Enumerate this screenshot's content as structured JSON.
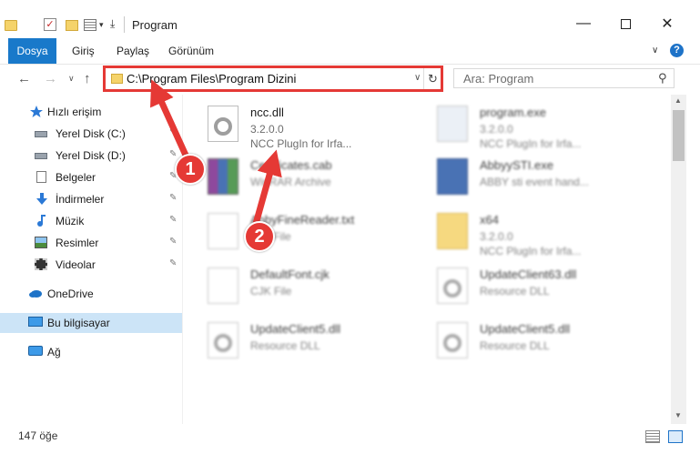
{
  "window": {
    "title": "Program",
    "controls": {
      "minimize": "—",
      "close": "✕"
    }
  },
  "ribbon": {
    "tabs": [
      {
        "label": "Dosya",
        "active": true
      },
      {
        "label": "Giriş"
      },
      {
        "label": "Paylaş"
      },
      {
        "label": "Görünüm"
      }
    ],
    "collapse_glyph": "∨",
    "help_glyph": "?"
  },
  "navigation": {
    "back_glyph": "←",
    "forward_glyph": "→",
    "recent_glyph": "∨",
    "up_glyph": "↑",
    "address": "C:\\Program Files\\Program Dizini",
    "address_dropdown_glyph": "∨",
    "refresh_glyph": "↻",
    "search_placeholder": "Ara: Program",
    "search_glyph": "⚲"
  },
  "sidebar": {
    "items": [
      {
        "label": "Hızlı erişim",
        "icon": "star-icon"
      },
      {
        "label": "Yerel Disk (C:)",
        "icon": "drive-icon",
        "pinned": true
      },
      {
        "label": "Yerel Disk (D:)",
        "icon": "drive-icon",
        "pinned": true
      },
      {
        "label": "Belgeler",
        "icon": "documents-icon",
        "pinned": true
      },
      {
        "label": "İndirmeler",
        "icon": "download-icon",
        "pinned": true
      },
      {
        "label": "Müzik",
        "icon": "music-icon",
        "pinned": true
      },
      {
        "label": "Resimler",
        "icon": "pictures-icon",
        "pinned": true
      },
      {
        "label": "Videolar",
        "icon": "video-icon",
        "pinned": true
      },
      {
        "label": "OneDrive",
        "icon": "cloud-icon"
      },
      {
        "label": "Bu bilgisayar",
        "icon": "computer-icon",
        "selected": true
      },
      {
        "label": "Ağ",
        "icon": "network-icon"
      }
    ],
    "pin_glyph": "✎"
  },
  "files": [
    {
      "name": "ncc.dll",
      "line1": "3.2.0.0",
      "line2": "NCC PlugIn for Irfa...",
      "icon": "dll-gear-icon",
      "highlighted": true
    },
    {
      "name": "program.exe",
      "line1": "3.2.0.0",
      "line2": "NCC PlugIn for Irfa...",
      "icon": "exe-icon"
    },
    {
      "name": "Certificates.cab",
      "line1": "WinRAR Archive",
      "icon": "archive-icon"
    },
    {
      "name": "AbbyySTI.exe",
      "line1": "ABBY sti event hand...",
      "icon": "exe-icon"
    },
    {
      "name": "AbbyFineReader.txt",
      "line1": "Text File",
      "icon": "text-file-icon"
    },
    {
      "name": "x64",
      "line1": "3.2.0.0",
      "line2": "NCC PlugIn for Irfa...",
      "icon": "folder-icon"
    },
    {
      "name": "DefaultFont.cjk",
      "line1": "CJK File",
      "icon": "file-icon"
    },
    {
      "name": "UpdateClient63.dll",
      "line1": "Resource DLL",
      "icon": "dll-gear-icon"
    },
    {
      "name": "UpdateClient5.dll",
      "line1": "Resource DLL",
      "icon": "dll-gear-icon"
    },
    {
      "name": "UpdateClient5.dll",
      "line1": "Resource DLL",
      "icon": "dll-gear-icon"
    }
  ],
  "status": {
    "count": "147 öğe"
  },
  "callouts": [
    {
      "number": "1"
    },
    {
      "number": "2"
    }
  ],
  "colors": {
    "accent": "#1979ca",
    "highlight": "#e53935",
    "selected": "#cce4f7"
  }
}
